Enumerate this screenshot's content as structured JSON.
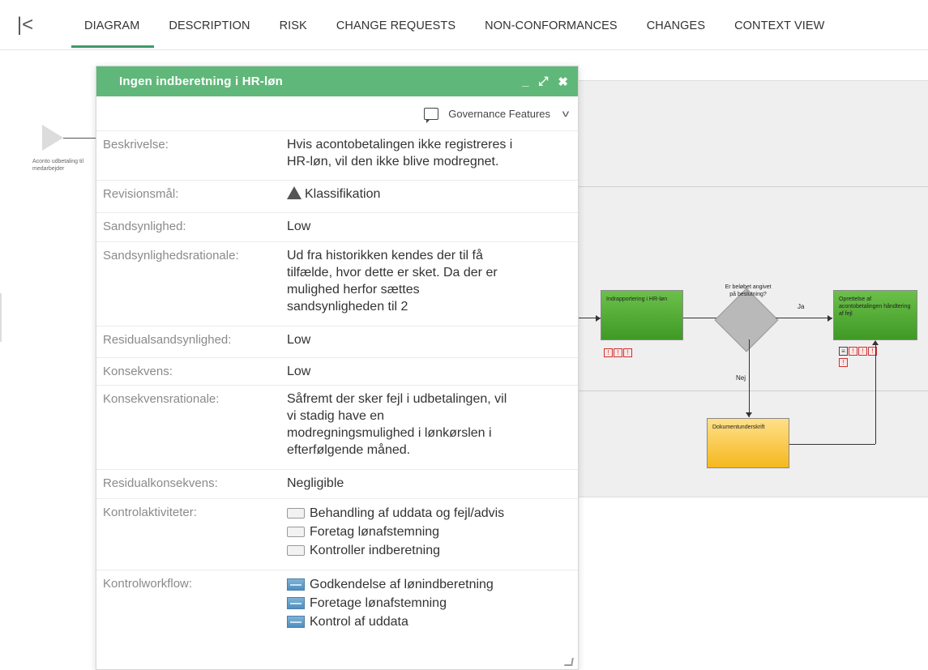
{
  "nav": {
    "collapse_glyph": "|<",
    "tabs": [
      {
        "label": "DIAGRAM",
        "active": true
      },
      {
        "label": "DESCRIPTION"
      },
      {
        "label": "RISK"
      },
      {
        "label": "CHANGE REQUESTS"
      },
      {
        "label": "NON-CONFORMANCES"
      },
      {
        "label": "CHANGES"
      },
      {
        "label": "CONTEXT VIEW"
      }
    ]
  },
  "diagram": {
    "start_label": "Aconto udbetaling til medarbejder",
    "task_1": "Indrapportering i HR-løn",
    "gateway": "Er beløbet angivet på beslutning?",
    "task_2": "Oprettelse af acontobetalingen håndtering af fejl",
    "task_3": "Dokumentunderskrift",
    "flow_yes": "Ja",
    "flow_no": "Nej"
  },
  "panel": {
    "title": "Ingen indberetning i HR-løn",
    "governance_label": "Governance Features",
    "properties": {
      "beskrivelse": {
        "label": "Beskrivelse:",
        "lines": [
          "Hvis acontobetalingen ikke registreres i",
          "HR-løn, vil den ikke blive modregnet."
        ]
      },
      "revisionsmaal": {
        "label": "Revisionsmål:",
        "value": "Klassifikation"
      },
      "sandsynlighed": {
        "label": "Sandsynlighed:",
        "value": "Low"
      },
      "sandsynlighedsrationale": {
        "label": "Sandsynlighedsrationale:",
        "lines": [
          "Ud fra historikken kendes der til få",
          "tilfælde, hvor dette er sket. Da der er",
          "mulighed herfor sættes",
          "sandsynligheden til 2"
        ]
      },
      "residualsandsynlighed": {
        "label": "Residualsandsynlighed:",
        "value": "Low"
      },
      "konsekvens": {
        "label": "Konsekvens:",
        "value": "Low"
      },
      "konsekvensrationale": {
        "label": "Konsekvensrationale:",
        "lines": [
          "Såfremt der sker fejl i udbetalingen, vil",
          "vi stadig have en",
          "modregningsmulighed i lønkørslen i",
          "efterfølgende måned."
        ]
      },
      "residualkonsekvens": {
        "label": "Residualkonsekvens:",
        "value": "Negligible"
      },
      "kontrolaktiviteter": {
        "label": "Kontrolaktiviteter:",
        "items": [
          "Behandling af uddata og fejl/advis",
          "Foretag lønafstemning",
          "Kontroller indberetning"
        ]
      },
      "kontrolworkflow": {
        "label": "Kontrolworkflow:",
        "items": [
          "Godkendelse af lønindberetning",
          "Foretage lønafstemning",
          "Kontrol af uddata"
        ]
      }
    }
  },
  "colors": {
    "accent": "#3e9a6b",
    "panel_header": "#5fb879",
    "task_green": "#4fa92f",
    "task_yellow": "#f5b81e",
    "risk": "#cc3333"
  }
}
